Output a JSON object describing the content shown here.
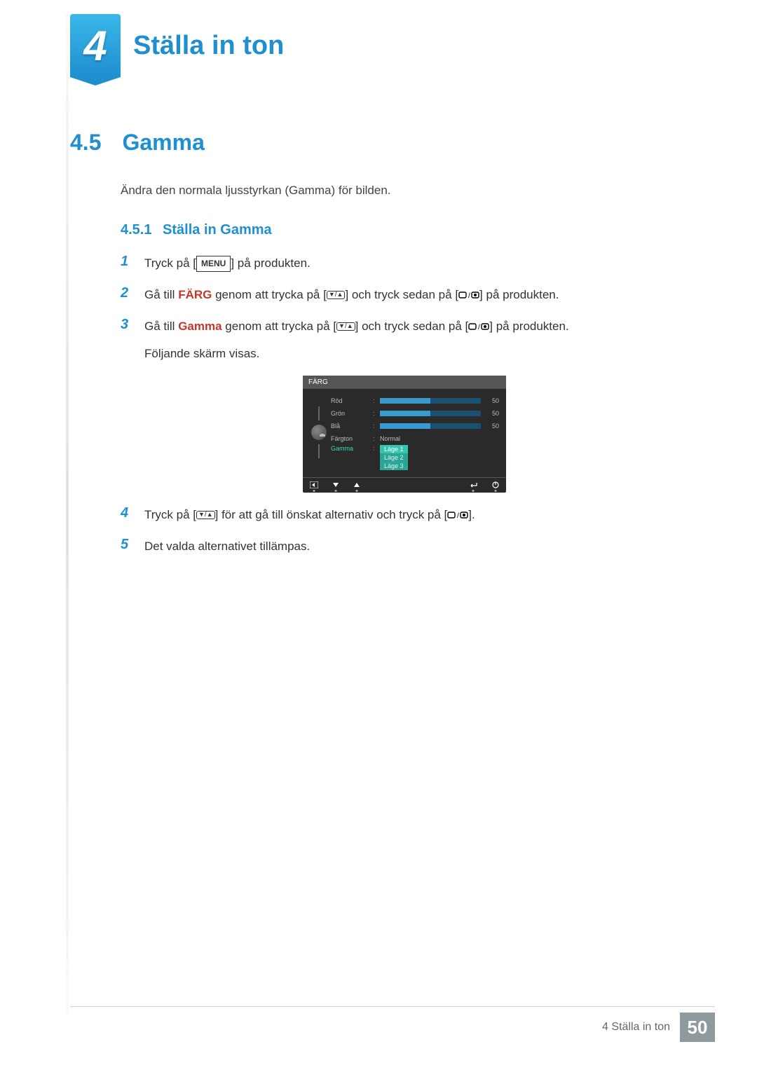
{
  "chapter": {
    "number": "4",
    "title": "Ställa in ton"
  },
  "section": {
    "number": "4.5",
    "title": "Gamma",
    "intro": "Ändra den normala ljusstyrkan (Gamma) för bilden."
  },
  "subsection": {
    "number": "4.5.1",
    "title": "Ställa in Gamma"
  },
  "buttons": {
    "menu": "MENU"
  },
  "steps": {
    "s1": {
      "num": "1",
      "t1": "Tryck på [",
      "t2": "] på produkten."
    },
    "s2": {
      "num": "2",
      "t1": "Gå till ",
      "bold": "FÄRG",
      "t2": " genom att trycka på [",
      "t3": "] och tryck sedan på [",
      "t4": "] på produkten."
    },
    "s3": {
      "num": "3",
      "t1": "Gå till ",
      "bold": "Gamma",
      "t2": " genom att trycka på [",
      "t3": "] och tryck sedan på [",
      "t4": "] på produkten.",
      "t5": "Följande skärm visas."
    },
    "s4": {
      "num": "4",
      "t1": "Tryck på [",
      "t2": "] för att gå till önskat alternativ och tryck på [",
      "t3": "]."
    },
    "s5": {
      "num": "5",
      "t1": "Det valda alternativet tillämpas."
    }
  },
  "osd": {
    "title": "FÄRG",
    "rows": {
      "red": {
        "label": "Röd",
        "value": "50",
        "fill": 50
      },
      "green": {
        "label": "Grön",
        "value": "50",
        "fill": 50
      },
      "blue": {
        "label": "Blå",
        "value": "50",
        "fill": 50
      },
      "tone": {
        "label": "Färgton",
        "value": "Normal"
      },
      "gamma": {
        "label": "Gamma",
        "options": [
          "Läge 1",
          "Läge 2",
          "Läge 3"
        ],
        "selected": 0
      }
    }
  },
  "footer": {
    "text": "4 Ställa in ton",
    "page": "50"
  },
  "chart_data": {
    "type": "bar",
    "title": "FÄRG sliders",
    "categories": [
      "Röd",
      "Grön",
      "Blå"
    ],
    "values": [
      50,
      50,
      50
    ],
    "ylim": [
      0,
      100
    ]
  }
}
